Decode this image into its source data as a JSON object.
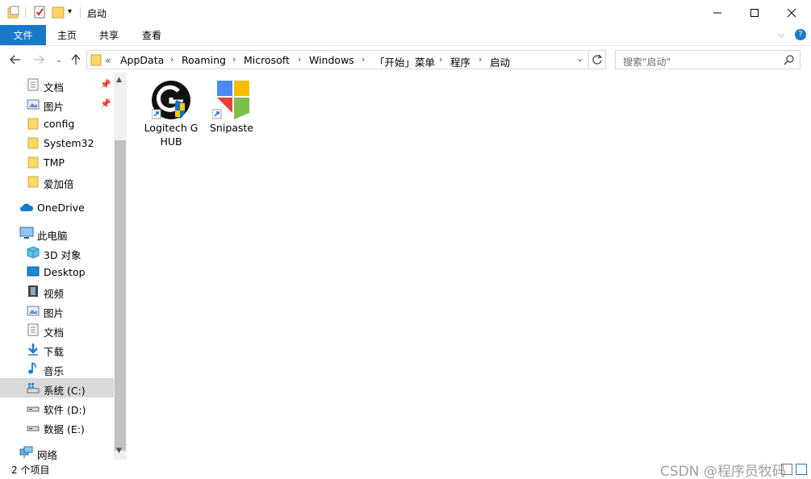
{
  "window": {
    "title": "启动"
  },
  "ribbon": {
    "tabs": [
      "文件",
      "主页",
      "共享",
      "查看"
    ]
  },
  "address": {
    "overflow": "«",
    "crumbs": [
      "AppData",
      "Roaming",
      "Microsoft",
      "Windows",
      "「开始」菜单",
      "程序",
      "启动"
    ]
  },
  "search": {
    "placeholder": "搜索\"启动\""
  },
  "nav": {
    "quick_access": [
      {
        "label": "文档",
        "icon": "document-icon",
        "pinned": true
      },
      {
        "label": "图片",
        "icon": "pictures-icon",
        "pinned": true
      },
      {
        "label": "config",
        "icon": "folder-icon"
      },
      {
        "label": "System32",
        "icon": "folder-icon"
      },
      {
        "label": "TMP",
        "icon": "folder-icon"
      },
      {
        "label": "爱加倍",
        "icon": "folder-icon"
      }
    ],
    "onedrive": "OneDrive",
    "this_pc": "此电脑",
    "pc_items": [
      {
        "label": "3D 对象",
        "icon": "3d-objects-icon"
      },
      {
        "label": "Desktop",
        "icon": "desktop-icon"
      },
      {
        "label": "视频",
        "icon": "video-icon"
      },
      {
        "label": "图片",
        "icon": "pictures-icon"
      },
      {
        "label": "文档",
        "icon": "document-icon"
      },
      {
        "label": "下载",
        "icon": "download-icon"
      },
      {
        "label": "音乐",
        "icon": "music-icon"
      },
      {
        "label": "系统 (C:)",
        "icon": "system-drive-icon",
        "selected": true
      },
      {
        "label": "软件 (D:)",
        "icon": "drive-icon"
      },
      {
        "label": "数据 (E:)",
        "icon": "drive-icon"
      }
    ],
    "network": "网络"
  },
  "files": [
    {
      "name": "Logitech G HUB",
      "icon": "logitech-ghub-icon"
    },
    {
      "name": "Snipaste",
      "icon": "snipaste-icon"
    }
  ],
  "status": {
    "count": "2 个项目",
    "watermark": "CSDN @程序员牧码"
  },
  "colors": {
    "accent": "#1979ca",
    "folder": "#ffd766",
    "selected": "#d9d9d9"
  }
}
